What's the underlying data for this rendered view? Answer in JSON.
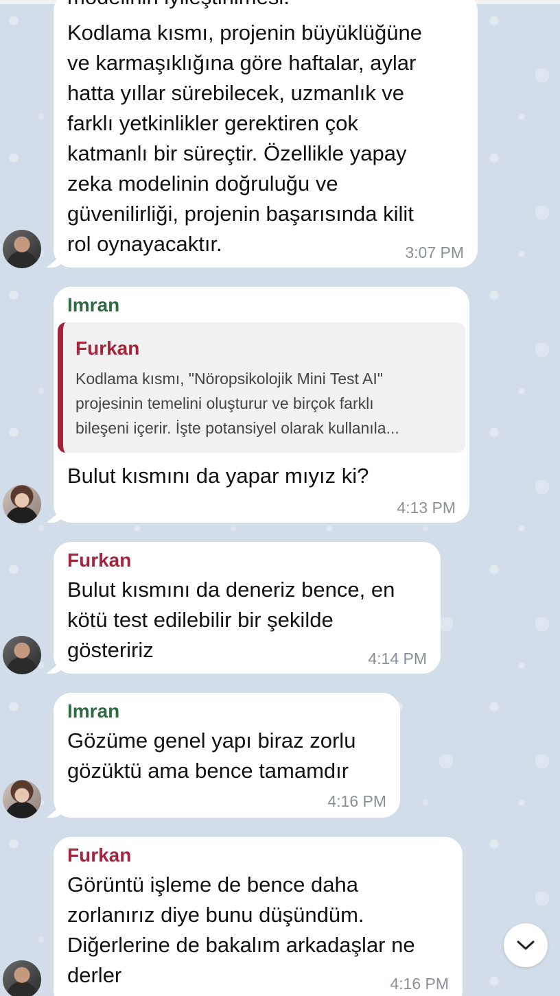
{
  "messages": [
    {
      "text_cut": "modelinin iyileştirilmesi.",
      "text": "Kodlama kısmı, projenin büyüklüğüne\nve karmaşıklığına göre haftalar, aylar\nhatta yıllar sürebilecek, uzmanlık ve\nfarklı yetkinlikler gerektiren çok\nkatmanlı bir süreçtir. Özellikle yapay\nzeka modelinin doğruluğu ve\ngüvenilirliği, projenin başarısında kilit\nrol oynayacaktır.",
      "time": "3:07 PM"
    },
    {
      "sender": "Imran",
      "reply_sender": "Furkan",
      "reply_text": "Kodlama kısmı, \"Nöropsikolojik Mini Test AI\"\nprojesinin temelini oluşturur ve birçok farklı\nbileşeni içerir. İşte potansiyel olarak kullanıla...",
      "text": "Bulut kısmını da yapar mıyız ki?",
      "time": "4:13 PM"
    },
    {
      "sender": "Furkan",
      "text": "Bulut kısmını da deneriz bence, en\nkötü test edilebilir bir şekilde\ngösteririz",
      "time": "4:14 PM"
    },
    {
      "sender": "Imran",
      "text": "Gözüme genel yapı biraz zorlu\ngözüktü ama bence tamamdır",
      "time": "4:16 PM"
    },
    {
      "sender": "Furkan",
      "text": "Görüntü işleme de bence daha\nzorlanırız diye bunu düşündüm.\nDiğerlerine de bakalım arkadaşlar ne\nderler",
      "time": "4:16 PM"
    }
  ],
  "icons": {
    "scroll_down": "chevron-down-icon",
    "avatar_furkan": "avatar-furkan",
    "avatar_imran": "avatar-imran"
  },
  "colors": {
    "background": "#d3dde9",
    "imran_name": "#2e6b43",
    "furkan_name": "#a3243b",
    "bubble": "#ffffff",
    "timestamp": "#8a8f96"
  }
}
